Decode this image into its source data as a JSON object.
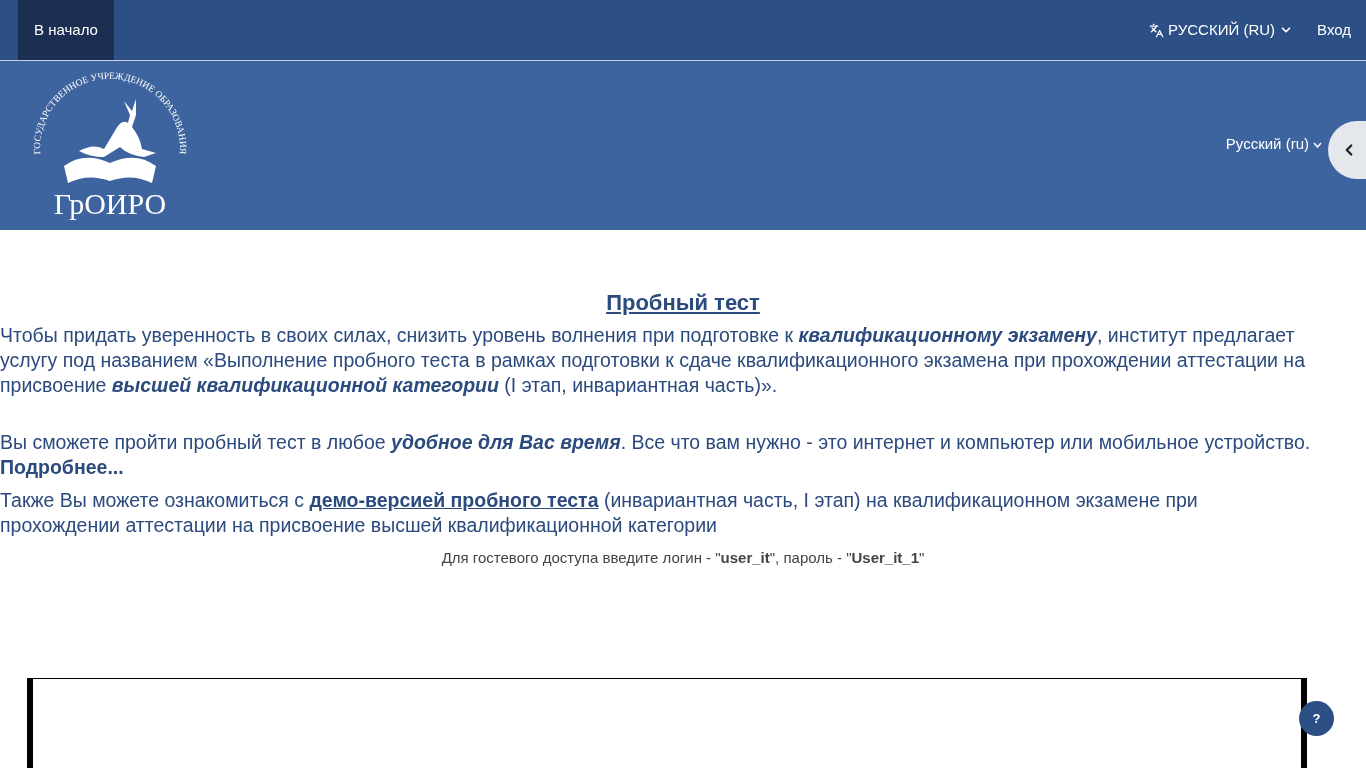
{
  "navbar": {
    "home": {
      "label": "В начало",
      "selected": true
    },
    "language": "РУССКИЙ (RU)",
    "login": "Вход"
  },
  "header": {
    "logo": {
      "arc_text": "ГОСУДАРСТВЕННОЕ УЧРЕЖДЕНИЕ ОБРАЗОВАНИЯ",
      "name": "ГрОИРО"
    },
    "language_menu": "Русский (ru)"
  },
  "content": {
    "title": "Пробный тест",
    "paragraphs": [
      [
        {
          "kind": "plain",
          "text": "Чтобы придать уверенность в своих силах, снизить уровень волнения при подготовке к "
        },
        {
          "kind": "emphasis",
          "text": "квалификационному экзамену"
        },
        {
          "kind": "plain",
          "text": ", институт предлагает  услугу под названием «Выполнение пробного теста в рамках подготовки к сдаче квалификационного экзамена при прохождении аттестации на присвоение "
        },
        {
          "kind": "emphasis",
          "text": "высшей квалификационной категории"
        },
        {
          "kind": "plain",
          "text": " (I этап, инвариантная часть)»."
        }
      ],
      [
        {
          "kind": "plain",
          "text": "Вы сможете пройти пробный тест в любое "
        },
        {
          "kind": "emphasis",
          "text": "удобное для Вас время"
        },
        {
          "kind": "plain",
          "text": ". Все что вам нужно - это интернет и компьютер или мобильное устройство. "
        },
        {
          "kind": "strong",
          "text": "Подробнее..."
        }
      ],
      [
        {
          "kind": "plain",
          "text": "Также Вы можете ознакомиться с "
        },
        {
          "kind": "link",
          "text": "демо-версией пробного теста"
        },
        {
          "kind": "plain",
          "text": " (инвариантная часть, I этап) на квалификационном экзамене при прохождении аттестации на присвоение высшей квалификационной категории"
        }
      ]
    ],
    "note": "Для гостевого доступа введите логин - \"**user_it**\", пароль - \"**User_it_1**\""
  },
  "help_button": "?"
}
